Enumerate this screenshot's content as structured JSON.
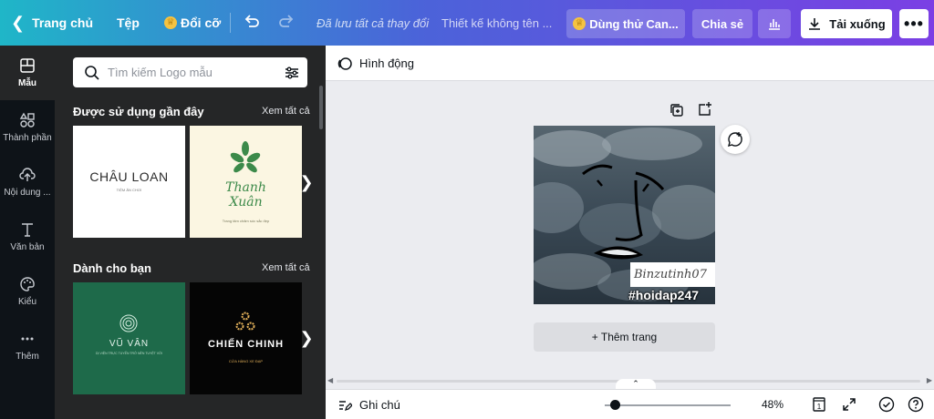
{
  "topbar": {
    "home_label": "Trang chủ",
    "file_label": "Tệp",
    "resize_label": "Đổi cỡ",
    "saved_status": "Đã lưu tất cả thay đổi",
    "design_title": "Thiết kế không tên ...",
    "try_label": "Dùng thử Can...",
    "share_label": "Chia sẻ",
    "download_label": "Tải xuống",
    "more_label": "•••",
    "gradient_start": "#1fb6c8",
    "gradient_end": "#7b3fe4"
  },
  "rail": {
    "items": [
      {
        "label": "Mẫu",
        "icon": "layout-icon",
        "active": true
      },
      {
        "label": "Thành phần",
        "icon": "elements-icon"
      },
      {
        "label": "Nội dung ...",
        "icon": "upload-icon"
      },
      {
        "label": "Văn bản",
        "icon": "text-icon"
      },
      {
        "label": "Kiểu",
        "icon": "palette-icon"
      },
      {
        "label": "Thêm",
        "icon": "more-icon"
      }
    ]
  },
  "panel": {
    "search_placeholder": "Tìm kiếm Logo mẫu",
    "recent_title": "Được sử dụng gần đây",
    "recent_link": "Xem tất cả",
    "foryou_title": "Dành cho bạn",
    "foryou_link": "Xem tất cả",
    "templates": {
      "chau_loan": {
        "name": "CHÂU LOAN",
        "sub": "TIỆM ĂN CHƠI"
      },
      "thanh_xuan": {
        "name": "Thanh Xuân",
        "sub": "Trang tâm chăm sóc sắc đẹp"
      },
      "vu_van": {
        "name": "VŨ VÂN",
        "sub": "DỊ VIỆN TRỰC TUYẾN TRỞ NÊN TUYỆT VỜI"
      },
      "chien_chinh": {
        "name": "CHIẾN CHINH",
        "sub": "CỬA HÀNG XE ĐẠP"
      }
    }
  },
  "secbar": {
    "animate_label": "Hình động"
  },
  "canvas": {
    "signature": "Binzutinh07",
    "hashtag": "#hoidap247",
    "add_page_label": "+ Thêm trang"
  },
  "bottombar": {
    "notes_label": "Ghi chú",
    "zoom_value": "48%",
    "zoom_level": 0.08,
    "page_count": "1"
  }
}
